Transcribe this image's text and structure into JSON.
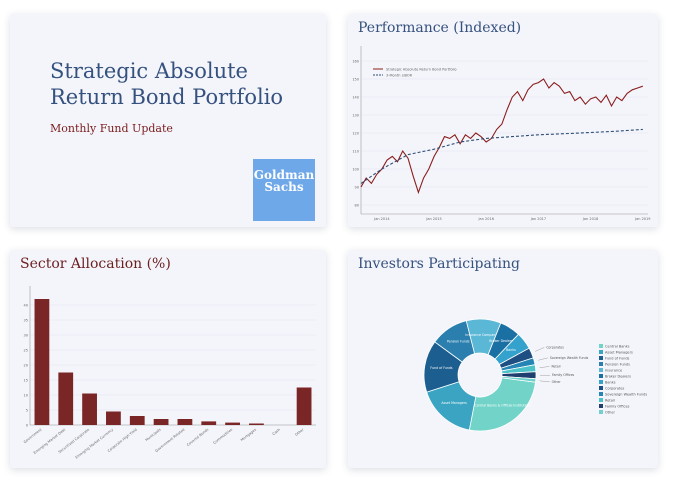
{
  "cover": {
    "title": "Strategic Absolute Return Bond Portfolio",
    "subtitle": "Monthly Fund Update",
    "logo_line1": "Goldman",
    "logo_line2": "Sachs",
    "logo_color": "#6fa8e8"
  },
  "performance": {
    "title": "Performance (Indexed)",
    "chart_data": {
      "type": "line",
      "title": "Performance (Indexed)",
      "y_ticks": [
        "80",
        "90",
        "100",
        "110",
        "120",
        "130",
        "140",
        "150",
        "160"
      ],
      "x_ticks": [
        "Jan 2014",
        "Jan 2015",
        "Jan 2016",
        "Jan 2017",
        "Jan 2018",
        "Jan 2019"
      ],
      "ylim": [
        75,
        165
      ],
      "xlim": [
        2013.6,
        2019.1
      ],
      "legend": [
        "Strategic Absolute Return Bond Portfolio",
        "3-Month LIBOR"
      ],
      "legend_position": "top-left",
      "series": [
        {
          "name": "Strategic Absolute Return Bond Portfolio",
          "color": "#8b1e1e",
          "style": "solid",
          "x": [
            2013.6,
            2013.7,
            2013.8,
            2013.9,
            2014.0,
            2014.1,
            2014.2,
            2014.3,
            2014.4,
            2014.5,
            2014.6,
            2014.7,
            2014.8,
            2014.9,
            2015.0,
            2015.1,
            2015.2,
            2015.3,
            2015.4,
            2015.5,
            2015.6,
            2015.7,
            2015.8,
            2015.9,
            2016.0,
            2016.1,
            2016.2,
            2016.3,
            2016.4,
            2016.5,
            2016.6,
            2016.7,
            2016.8,
            2016.9,
            2017.0,
            2017.1,
            2017.2,
            2017.3,
            2017.4,
            2017.5,
            2017.6,
            2017.7,
            2017.8,
            2017.9,
            2018.0,
            2018.1,
            2018.2,
            2018.3,
            2018.4,
            2018.5,
            2018.6,
            2018.7,
            2018.8,
            2018.9,
            2019.0
          ],
          "values": [
            90,
            95,
            92,
            97,
            100,
            105,
            107,
            104,
            110,
            106,
            96,
            87,
            95,
            100,
            107,
            112,
            118,
            117,
            119,
            114,
            119,
            117,
            120,
            118,
            115,
            117,
            122,
            125,
            133,
            140,
            143,
            138,
            144,
            147,
            148,
            150,
            145,
            148,
            146,
            142,
            143,
            138,
            140,
            136,
            139,
            140,
            137,
            141,
            135,
            140,
            138,
            142,
            144,
            145,
            146
          ]
        },
        {
          "name": "3-Month LIBOR",
          "color": "#2d4d75",
          "style": "dashed",
          "x": [
            2013.6,
            2014.0,
            2014.5,
            2015.0,
            2015.5,
            2016.0,
            2016.5,
            2017.0,
            2017.5,
            2018.0,
            2018.5,
            2019.0
          ],
          "values": [
            92,
            100,
            108,
            111,
            115,
            117,
            118,
            119,
            119.6,
            120.3,
            121,
            122
          ]
        }
      ]
    }
  },
  "sectors": {
    "title": "Sector Allocation (%)",
    "chart_data": {
      "type": "bar",
      "title": "Sector Allocation (%)",
      "categories": [
        "Government",
        "Emerging Market Debt",
        "Securitized Corporate",
        "Emerging Market Currency",
        "Corporate High Yield",
        "Municipals",
        "Government Related",
        "Covered Bonds",
        "Commodities",
        "Mortgages",
        "Cash",
        "Other"
      ],
      "values": [
        42,
        17.5,
        10.5,
        4.5,
        3,
        2,
        2,
        1.2,
        0.8,
        0.5,
        0,
        12.5
      ],
      "y_ticks": [
        "0",
        "5",
        "10",
        "15",
        "20",
        "25",
        "30",
        "35",
        "40"
      ],
      "ylim": [
        0,
        45
      ],
      "color": "#7a2526"
    }
  },
  "investors": {
    "title": "Investors Participating",
    "chart_data": {
      "type": "pie",
      "title": "Investors Participating",
      "legend_position": "right",
      "labels": [
        "Central Banks & Official Institutions",
        "Asset Managers",
        "Fund of Funds",
        "Pension Funds",
        "Insurance Companies",
        "Broker Dealers",
        "Banks",
        "Corporates",
        "Sovereign Wealth Funds",
        "Retail",
        "Family Offices",
        "Other"
      ],
      "values": [
        26,
        17,
        15,
        11,
        10,
        6,
        5,
        3,
        2,
        2,
        2,
        1
      ],
      "colors": [
        "#72d3c9",
        "#3aa4c2",
        "#1c5e8f",
        "#2a7fae",
        "#5bb7d6",
        "#1a6fa3",
        "#34a2cc",
        "#1d4f82",
        "#2586b5",
        "#4dc2c9",
        "#1f3f6e",
        "#6fd0cc"
      ],
      "legend": [
        "Central Banks",
        "Asset Managers",
        "Fund of Funds",
        "Pension Funds",
        "Insurance",
        "Broker Dealers",
        "Banks",
        "Corporates",
        "Sovereign Wealth Funds",
        "Retail",
        "Family Offices",
        "Other"
      ]
    }
  }
}
